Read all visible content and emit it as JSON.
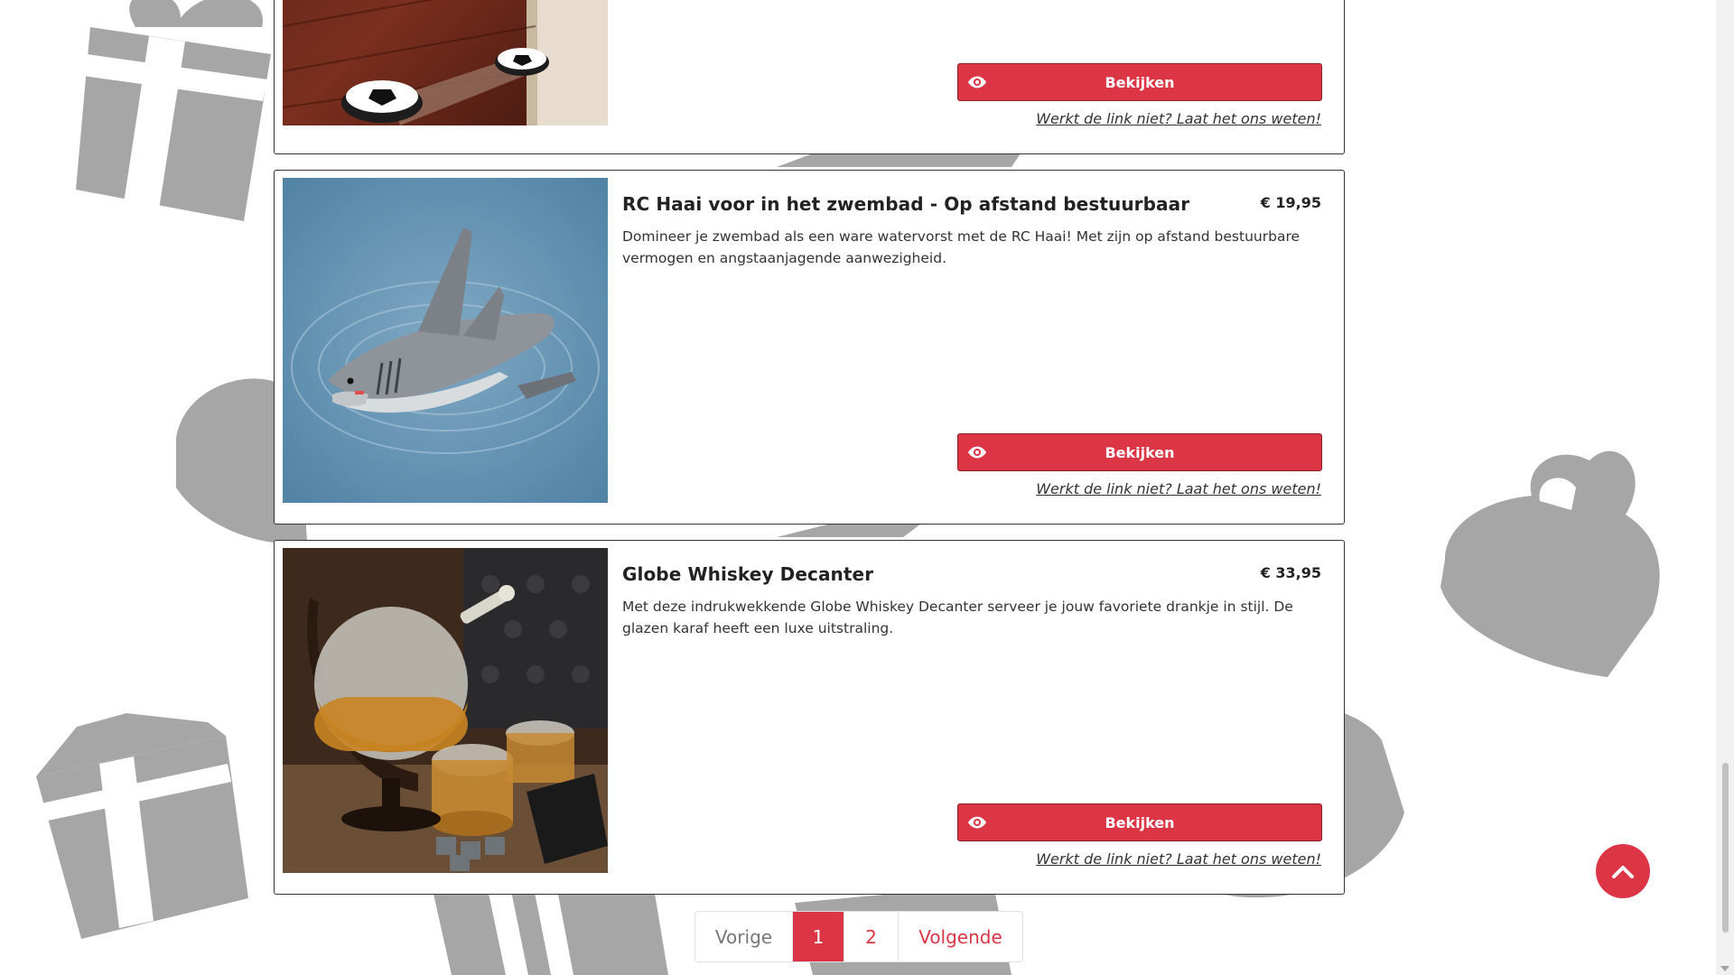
{
  "products": [
    {
      "title": "",
      "price": "",
      "description": "",
      "button_label": "Bekijken",
      "report_link": "Werkt de link niet? Laat het ons weten!",
      "image_icon": "hover-football-image"
    },
    {
      "title": "RC Haai voor in het zwembad - Op afstand bestuurbaar",
      "price": "€ 19,95",
      "description": "Domineer je zwembad als een ware watervorst met de RC Haai! Met zijn op afstand bestuurbare vermogen en angstaanjagende aanwezigheid.",
      "button_label": "Bekijken",
      "report_link": "Werkt de link niet? Laat het ons weten!",
      "image_icon": "rc-shark-image"
    },
    {
      "title": "Globe Whiskey Decanter",
      "price": "€ 33,95",
      "description": "Met deze indrukwekkende Globe Whiskey Decanter serveer je jouw favoriete drankje in stijl. De glazen karaf heeft een luxe uitstraling.",
      "button_label": "Bekijken",
      "report_link": "Werkt de link niet? Laat het ons weten!",
      "image_icon": "globe-decanter-image"
    }
  ],
  "pagination": {
    "prev": "Vorige",
    "pages": [
      "1",
      "2"
    ],
    "current": "1",
    "next": "Volgende"
  },
  "colors": {
    "accent": "#dc3545",
    "background_gifts": "#a6a6a6"
  },
  "icons": {
    "button": "eye-icon",
    "back_to_top": "chevron-up-icon",
    "background": "gift-box-icon"
  }
}
